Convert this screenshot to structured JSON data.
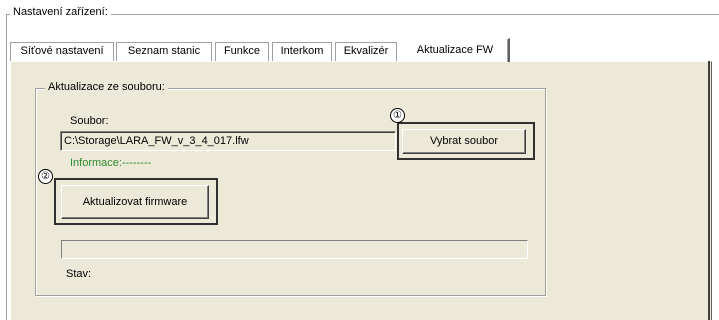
{
  "outer_group": {
    "legend": "Nastavení zařízení:"
  },
  "tabs": [
    {
      "label": "Síťové nastavení",
      "active": false
    },
    {
      "label": "Seznam stanic",
      "active": false
    },
    {
      "label": "Funkce",
      "active": false
    },
    {
      "label": "Interkom",
      "active": false
    },
    {
      "label": "Ekvalizér",
      "active": false
    },
    {
      "label": "Aktualizace FW",
      "active": true
    }
  ],
  "update_group": {
    "legend": "Aktualizace ze souboru:",
    "file_label": "Soubor:",
    "file_value": "C:\\Storage\\LARA_FW_v_3_4_017.lfw",
    "select_button": "Vybrat soubor",
    "info_label": "Informace:--------",
    "update_button": "Aktualizovat firmware",
    "progress": 0,
    "status_label": "Stav:"
  },
  "callouts": {
    "one": "①",
    "two": "②"
  },
  "colors": {
    "panel": "#ece9d8",
    "info": "#2e8b2e"
  }
}
